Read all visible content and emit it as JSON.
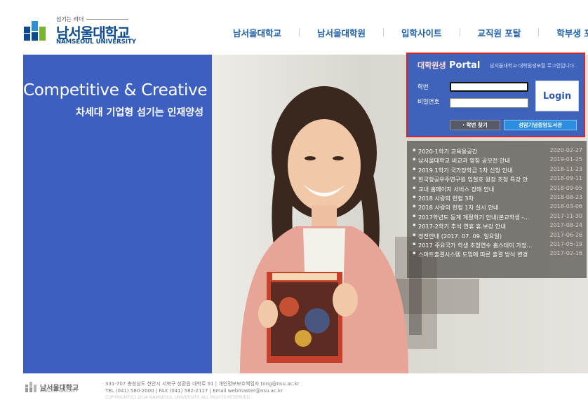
{
  "header": {
    "slogan": "섬기는 리더",
    "name_ko": "남서울대학교",
    "name_en": "NAMSEOUL UNIVERSITY",
    "nav": [
      {
        "label": "남서울대학교"
      },
      {
        "label": "남서울대학원"
      },
      {
        "label": "입학사이트"
      },
      {
        "label": "교직원 포탈"
      },
      {
        "label": "학부생 포탈"
      }
    ]
  },
  "hero": {
    "tagline_en": "Competitive & Creative",
    "tagline_ko": "차세대 기업형 섬기는 인재양성"
  },
  "portal": {
    "title_ko": "대학원생",
    "title_en": "Portal",
    "description": "남서울대학교 대학원생포탈 로그인입니다.",
    "id_label": "학번",
    "pw_label": "비밀번호",
    "id_value": "",
    "pw_value": "",
    "login_label": "Login",
    "find_id_label": "· 학번 찾기",
    "library_label": "성암기념중앙도서관"
  },
  "notices": [
    {
      "title": "2020-1학기 교육용공간",
      "date": "2020-02-27"
    },
    {
      "title": "남서울대학교 비교과 명칭 공모전 안내",
      "date": "2019-01-25"
    },
    {
      "title": "2019.1학기 국가장학금 1차 신청 안내",
      "date": "2018-11-23"
    },
    {
      "title": "한국항공우주연구원 임철호 원장 초청 특강 안",
      "date": "2018-09-11"
    },
    {
      "title": "교내 홈페이지 서비스 장애 안내",
      "date": "2018-09-05"
    },
    {
      "title": "2018 사랑의 헌혈 3차",
      "date": "2018-08-23"
    },
    {
      "title": "2018 사랑의 헌혈 1차 실시 안내",
      "date": "2018-03-06"
    },
    {
      "title": "2017학년도 동계 계절학기 안내(본교학생 -...",
      "date": "2017-11-30"
    },
    {
      "title": "2017-2학기 추석 연휴 휴.보강 안내",
      "date": "2017-08-24"
    },
    {
      "title": "정전안내 (2017. 07. 09. 일요일)",
      "date": "2017-06-26"
    },
    {
      "title": "2017 주요국가 학생 초청연수 홈스테이 가정...",
      "date": "2017-05-19"
    },
    {
      "title": "스마트출결시스템 도입에 따른 출결 방식 변경",
      "date": "2017-02-16"
    }
  ],
  "footer": {
    "logo_text": "남서울대학교",
    "logo_text_en": "NAMSEOUL UNIVERSITY",
    "address_line": "331-707 충청남도 천안시 서북구 성환읍 대학로 91  |  개인정보보호책임자 tong@nsu.ac.kr",
    "contact_line": "TEL (041) 580-2000  |  FAX (041) 582-2117  |  Email webmaster@nsu.ac.kr",
    "copyright_line": "COPYRIGHT(C) 2014 NAMSEOUL UNIVERSITY. ALL RIGHTS RESERVED."
  },
  "colors": {
    "brand_blue": "#0d4a8f",
    "nav_blue": "#1f5fa8",
    "hero_blue": "#3d5fbf",
    "portal_blue": "#3e63b9",
    "portal_border": "#d4262b"
  }
}
